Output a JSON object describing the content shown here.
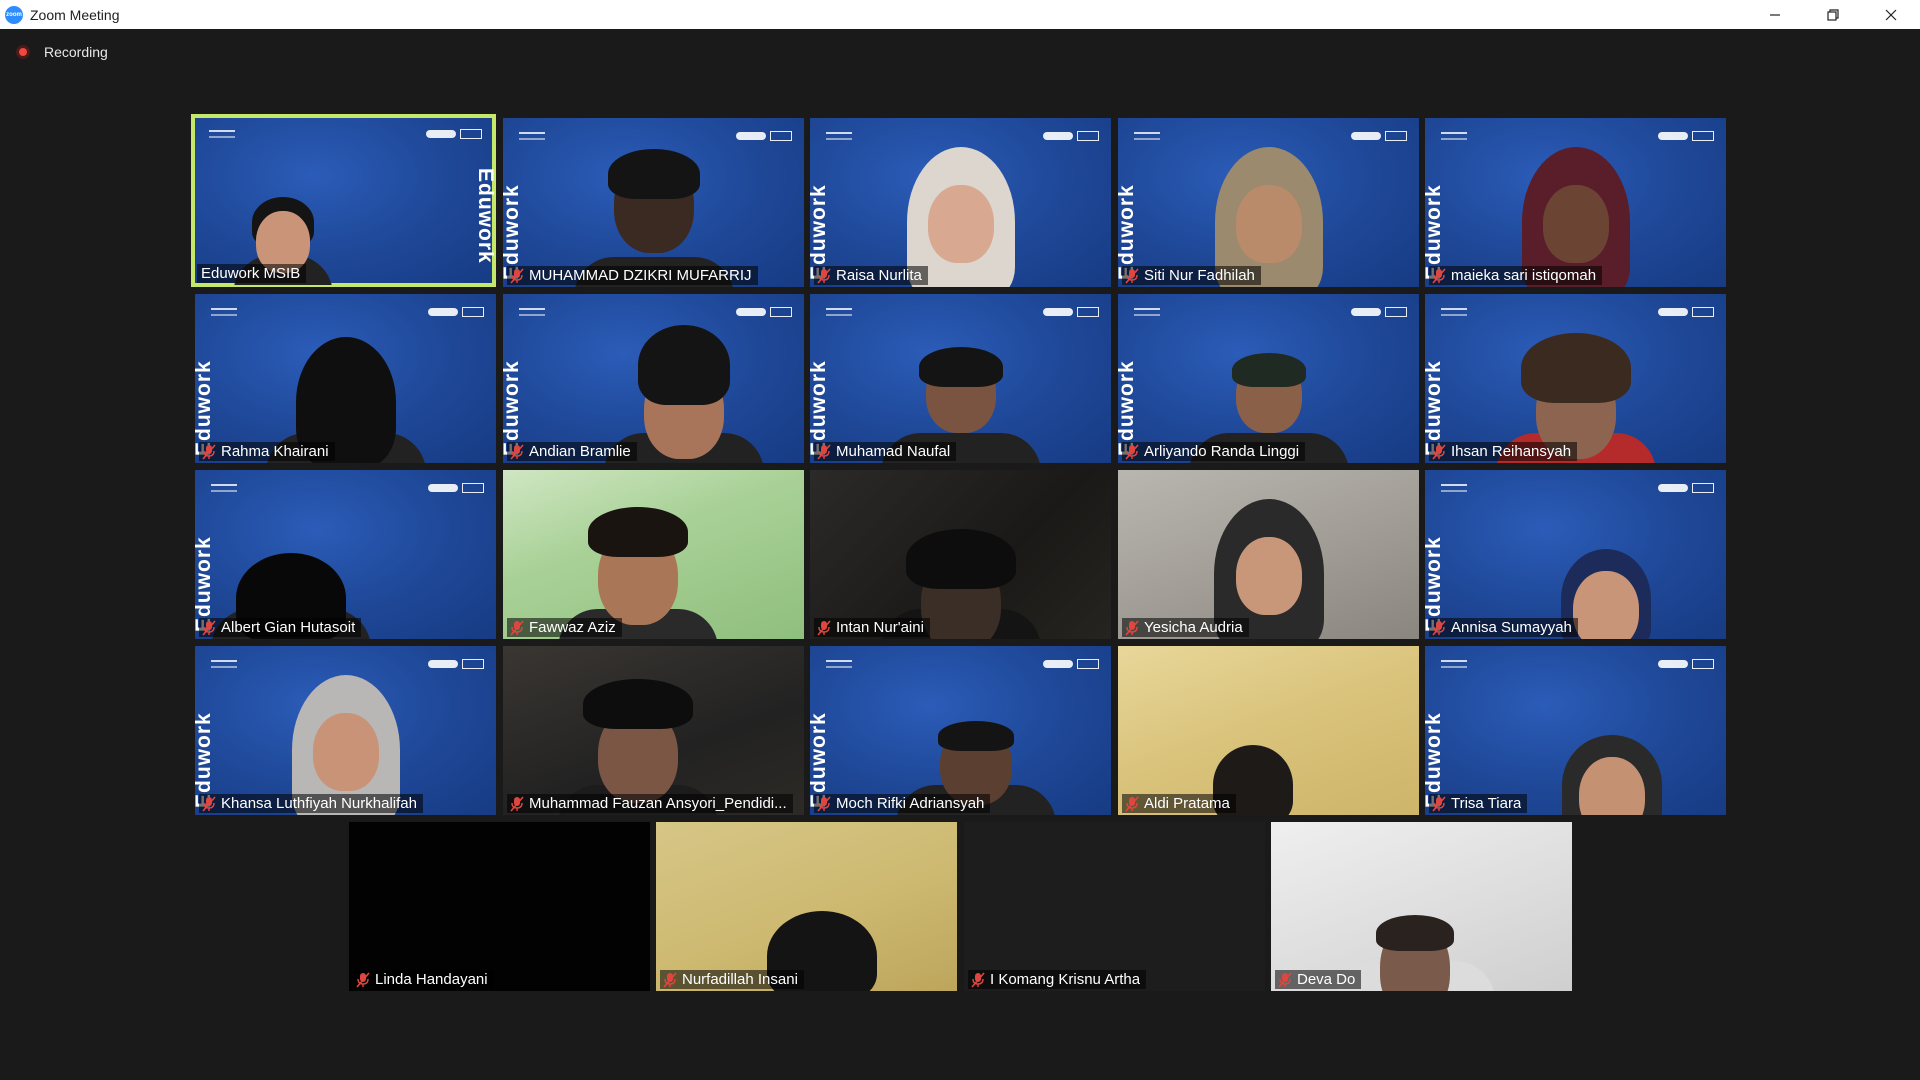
{
  "window": {
    "title": "Zoom Meeting",
    "logo_text": "zoom",
    "minimize_icon": "minimize-icon",
    "restore_icon": "restore-icon",
    "close_icon": "close-icon"
  },
  "recording": {
    "label": "Recording",
    "color": "#f2463f"
  },
  "colors": {
    "active_speaker_border": "#c6e86a",
    "muted_mic": "#e0463f"
  },
  "participants": [
    {
      "name": "Eduwork MSIB",
      "muted": false,
      "active": true,
      "video": "blue-person"
    },
    {
      "name": "MUHAMMAD DZIKRI MUFARRIJ",
      "muted": true,
      "video": "blue-person"
    },
    {
      "name": "Raisa Nurlita",
      "muted": true,
      "video": "blue-hijab"
    },
    {
      "name": "Siti Nur Fadhilah",
      "muted": true,
      "video": "blue-hijab"
    },
    {
      "name": "maieka sari istiqomah",
      "muted": true,
      "video": "blue-hijab"
    },
    {
      "name": "Rahma Khairani",
      "muted": true,
      "video": "blue-person"
    },
    {
      "name": "Andian Bramlie",
      "muted": true,
      "video": "blue-person"
    },
    {
      "name": "Muhamad Naufal",
      "muted": true,
      "video": "blue-person"
    },
    {
      "name": "Arliyando Randa Linggi",
      "muted": true,
      "video": "blue-person"
    },
    {
      "name": "Ihsan Reihansyah",
      "muted": true,
      "video": "blue-person"
    },
    {
      "name": "Albert Gian Hutasoit",
      "muted": true,
      "video": "blue-person"
    },
    {
      "name": "Fawwaz Aziz",
      "muted": true,
      "video": "room"
    },
    {
      "name": "Intan Nur'aini",
      "muted": true,
      "video": "room"
    },
    {
      "name": "Yesicha Audria",
      "muted": true,
      "video": "room"
    },
    {
      "name": "Annisa Sumayyah",
      "muted": true,
      "video": "blue-hijab"
    },
    {
      "name": "Khansa Luthfiyah Nurkhalifah",
      "muted": true,
      "video": "blue-hijab"
    },
    {
      "name": "Muhammad Fauzan Ansyori_Pendidi...",
      "muted": true,
      "video": "room"
    },
    {
      "name": "Moch Rifki Adriansyah",
      "muted": true,
      "video": "blue-person"
    },
    {
      "name": "Aldi Pratama",
      "muted": true,
      "video": "room"
    },
    {
      "name": "Trisa Tiara",
      "muted": true,
      "video": "blue-hijab"
    },
    {
      "name": "Linda Handayani",
      "muted": true,
      "video": "off"
    },
    {
      "name": "Nurfadillah Insani",
      "muted": true,
      "video": "room"
    },
    {
      "name": "I Komang Krisnu Artha",
      "muted": true,
      "video": "off"
    },
    {
      "name": "Deva Do",
      "muted": true,
      "video": "room"
    }
  ]
}
